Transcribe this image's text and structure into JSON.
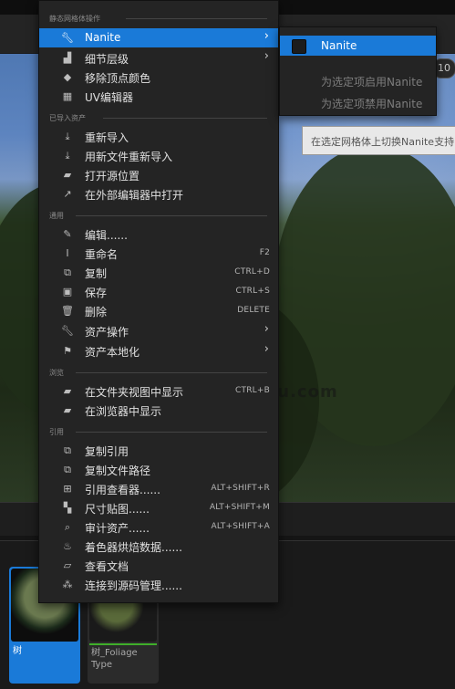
{
  "sections": {
    "static_mesh": "静态网格体操作",
    "imported": "已导入资产",
    "common": "通用",
    "browse": "浏览",
    "references": "引用"
  },
  "menu": {
    "nanite": "Nanite",
    "lod": "细节层级",
    "remove_vertex_colors": "移除顶点颜色",
    "uv_editor": "UV编辑器",
    "reimport": "重新导入",
    "reimport_new_file": "用新文件重新导入",
    "open_source_location": "打开源位置",
    "open_external_editor": "在外部编辑器中打开",
    "edit": "编辑......",
    "rename": "重命名",
    "rename_shortcut": "F2",
    "duplicate": "复制",
    "duplicate_shortcut": "CTRL+D",
    "save": "保存",
    "save_shortcut": "CTRL+S",
    "delete": "删除",
    "delete_shortcut": "DELETE",
    "asset_actions": "资产操作",
    "asset_localization": "资产本地化",
    "show_in_folder_view": "在文件夹视图中显示",
    "show_in_folder_view_shortcut": "CTRL+B",
    "show_in_browser": "在浏览器中显示",
    "copy_reference": "复制引用",
    "copy_file_path": "复制文件路径",
    "reference_viewer": "引用查看器......",
    "reference_viewer_shortcut": "ALT+SHIFT+R",
    "size_map": "尺寸贴图......",
    "size_map_shortcut": "ALT+SHIFT+M",
    "audit_assets": "审计资产......",
    "audit_assets_shortcut": "ALT+SHIFT+A",
    "shader_cook_stats": "着色器烘焙数据......",
    "view_documentation": "查看文档",
    "connect_source_control": "连接到源码管理......"
  },
  "submenu": {
    "nanite": "Nanite",
    "enable": "为选定项启用Nanite",
    "disable": "为选定项禁用Nanite"
  },
  "tooltip": "在选定网格体上切换Nanite支持",
  "viewport": {
    "badge": "10",
    "watermark": "iiiitu.com"
  },
  "assets": [
    {
      "label": "树"
    },
    {
      "label": "树_Foliage Type"
    }
  ],
  "colors": {
    "accent": "#1a7ad8",
    "menu_bg": "#242424",
    "foliage_bar": "#3fae2a"
  }
}
